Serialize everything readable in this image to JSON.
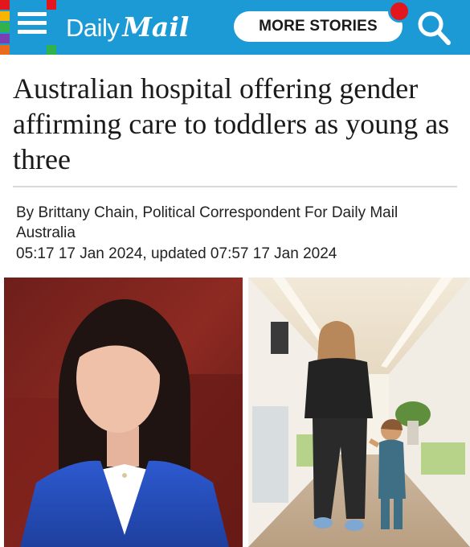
{
  "header": {
    "logo_daily": "Daily",
    "logo_mail": "Mail",
    "more_stories_label": "MORE STORIES"
  },
  "article": {
    "headline": "Australian hospital offering gender affirming care to toddlers as young as three",
    "byline": "By Brittany Chain, Political Correspondent For Daily Mail Australia",
    "timestamp": "05:17 17 Jan 2024, updated 07:57 17 Jan 2024"
  },
  "colors": {
    "header_bg": "#1c9ad6",
    "notification_dot": "#e3161d",
    "text": "#1a1a1a"
  },
  "icons": [
    "menu-icon",
    "search-icon",
    "notification-dot"
  ]
}
